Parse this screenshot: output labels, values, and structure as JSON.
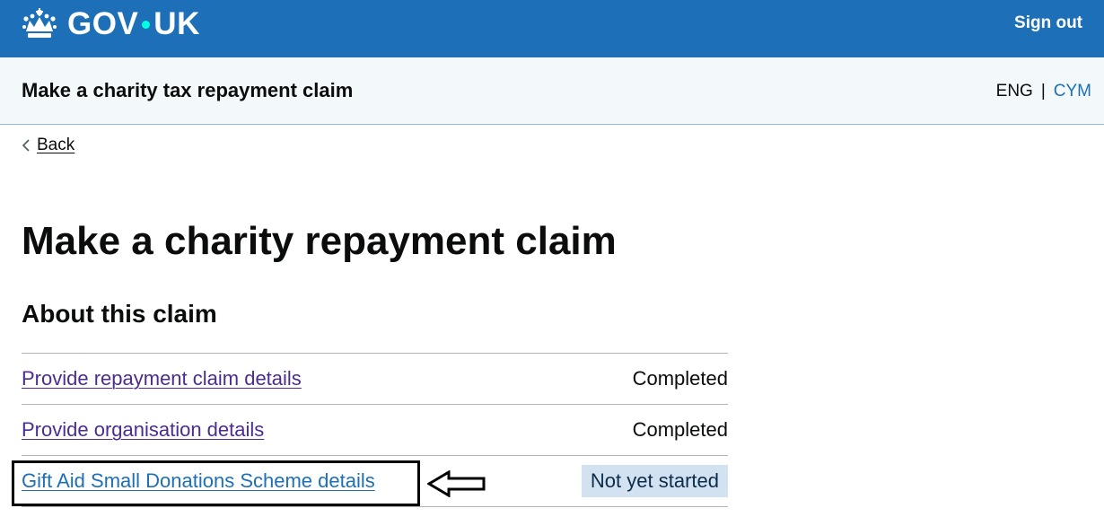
{
  "header": {
    "logo_text_left": "GOV",
    "logo_text_right": "UK",
    "sign_out_label": "Sign out",
    "logo_icon": "crown-icon"
  },
  "service": {
    "name": "Make a charity tax repayment claim",
    "lang_current": "ENG",
    "lang_separator": "|",
    "lang_other": "CYM"
  },
  "back": {
    "label": "Back",
    "icon": "chevron-left-icon"
  },
  "main": {
    "title": "Make a charity repayment claim",
    "section_title": "About this claim",
    "tasks": [
      {
        "label": "Provide repayment claim details",
        "status": "Completed"
      },
      {
        "label": "Provide organisation details",
        "status": "Completed"
      },
      {
        "label": "Gift Aid Small Donations Scheme details",
        "status": "Not yet started"
      }
    ]
  },
  "colors": {
    "brand_blue": "#1d70b8",
    "visited_link": "#4c2c92",
    "tag_background": "#d2e2f1",
    "logo_dot": "#00ffe0"
  },
  "annotation": {
    "icon": "left-arrow-outline-icon"
  }
}
